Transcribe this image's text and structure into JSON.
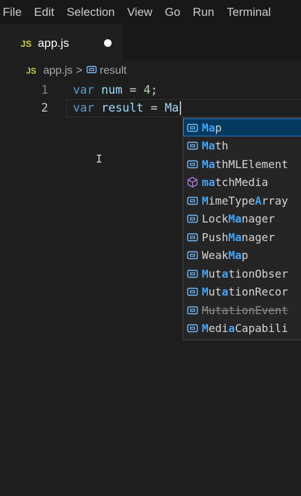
{
  "menu": [
    "File",
    "Edit",
    "Selection",
    "View",
    "Go",
    "Run",
    "Terminal"
  ],
  "tab": {
    "icon_text": "JS",
    "title": "app.js",
    "dirty": true
  },
  "breadcrumb": {
    "icon_text": "JS",
    "file": "app.js",
    "separator": ">",
    "symbol": "result",
    "symbol_icon": "variable-icon"
  },
  "editor": {
    "lines": [
      {
        "number": "1",
        "tokens": [
          {
            "t": "var",
            "c": "kw"
          },
          {
            "t": " "
          },
          {
            "t": "num",
            "c": "var"
          },
          {
            "t": " = "
          },
          {
            "t": "4",
            "c": "num"
          },
          {
            "t": ";"
          }
        ]
      },
      {
        "number": "2",
        "current": true,
        "tokens": [
          {
            "t": "var",
            "c": "kw"
          },
          {
            "t": " "
          },
          {
            "t": "result",
            "c": "var"
          },
          {
            "t": " = "
          },
          {
            "t": "Ma",
            "c": "var"
          }
        ]
      }
    ],
    "mouse_cursor": "text-cursor-icon"
  },
  "suggestions": [
    {
      "segments": [
        {
          "t": "Ma",
          "m": true
        },
        {
          "t": "p"
        }
      ],
      "kind": "variable",
      "selected": true
    },
    {
      "segments": [
        {
          "t": "Ma",
          "m": true
        },
        {
          "t": "th"
        }
      ],
      "kind": "variable"
    },
    {
      "segments": [
        {
          "t": "Ma",
          "m": true
        },
        {
          "t": "thMLElement"
        }
      ],
      "kind": "variable"
    },
    {
      "segments": [
        {
          "t": "ma",
          "m": true
        },
        {
          "t": "tchMedia"
        }
      ],
      "kind": "method"
    },
    {
      "segments": [
        {
          "t": "M",
          "m": true
        },
        {
          "t": "imeType"
        },
        {
          "t": "A",
          "m": true
        },
        {
          "t": "rray"
        }
      ],
      "kind": "variable"
    },
    {
      "segments": [
        {
          "t": "Lock"
        },
        {
          "t": "Ma",
          "m": true
        },
        {
          "t": "nager"
        }
      ],
      "kind": "variable"
    },
    {
      "segments": [
        {
          "t": "Push"
        },
        {
          "t": "Ma",
          "m": true
        },
        {
          "t": "nager"
        }
      ],
      "kind": "variable"
    },
    {
      "segments": [
        {
          "t": "Weak"
        },
        {
          "t": "Ma",
          "m": true
        },
        {
          "t": "p"
        }
      ],
      "kind": "variable"
    },
    {
      "segments": [
        {
          "t": "M",
          "m": true
        },
        {
          "t": "ut"
        },
        {
          "t": "a",
          "m": true
        },
        {
          "t": "tionObser"
        }
      ],
      "kind": "variable"
    },
    {
      "segments": [
        {
          "t": "M",
          "m": true
        },
        {
          "t": "ut"
        },
        {
          "t": "a",
          "m": true
        },
        {
          "t": "tionRecor"
        }
      ],
      "kind": "variable"
    },
    {
      "segments": [
        {
          "t": "M",
          "m": true
        },
        {
          "t": "ut"
        },
        {
          "t": "a",
          "m": true
        },
        {
          "t": "tionEvent"
        }
      ],
      "kind": "variable",
      "deprecated": true
    },
    {
      "segments": [
        {
          "t": "M",
          "m": true
        },
        {
          "t": "edi"
        },
        {
          "t": "a",
          "m": true
        },
        {
          "t": "Capabili"
        }
      ],
      "kind": "variable"
    }
  ],
  "colors": {
    "keyword": "#569cd6",
    "variable": "#9cdcfe",
    "number": "#b5cea8",
    "match": "#3ea6ff",
    "method_icon": "#b180d7",
    "variable_icon": "#75beff",
    "selection": "#04395e"
  }
}
